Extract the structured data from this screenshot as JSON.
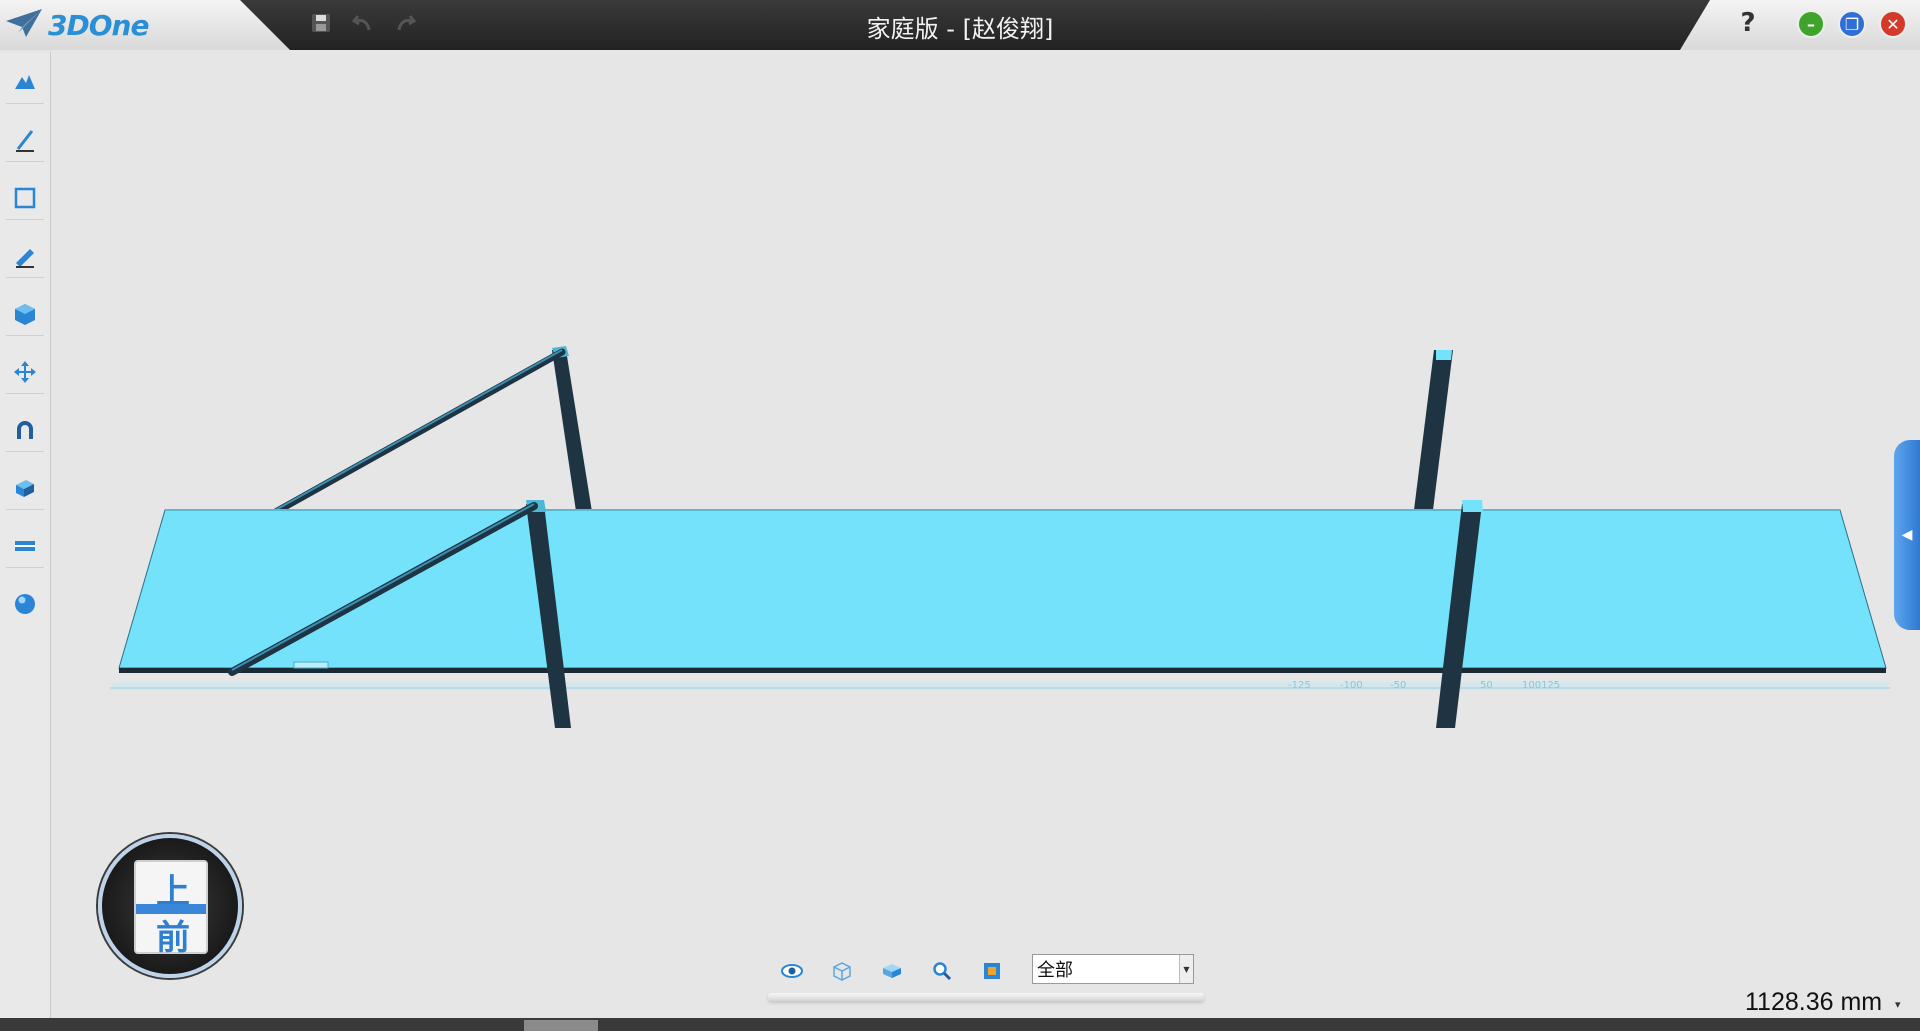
{
  "app": {
    "logo": "3DOne",
    "window_title": "家庭版 - [赵俊翔]",
    "help_label": "?"
  },
  "titlebar": {
    "icons": [
      "save-icon",
      "undo-icon",
      "redo-icon"
    ],
    "window_controls": [
      "minimize-icon",
      "restore-icon",
      "close-icon"
    ]
  },
  "left_toolbar": {
    "items": [
      "basic-solid-icon",
      "sketch-icon",
      "sketch-edit-icon",
      "special-function-icon",
      "combine-icon",
      "transform-icon",
      "snap-icon",
      "component-icon",
      "measure-icon",
      "render-sphere-icon"
    ]
  },
  "view_cube": {
    "top_label": "上",
    "front_label": "前"
  },
  "view_toolbar": {
    "icons": [
      "view-visibility-icon",
      "view-wireframe-icon",
      "view-shaded-icon",
      "zoom-icon",
      "fit-view-icon"
    ],
    "filter_value": "全部"
  },
  "status": {
    "measurement": "1128.36 mm"
  },
  "colors": {
    "plate_top": "#75e2fb",
    "plate_edge": "#1b2b35",
    "post": "#1e3442",
    "accent": "#2f7fd1"
  }
}
